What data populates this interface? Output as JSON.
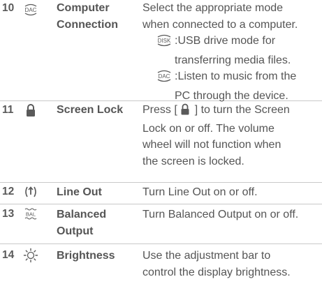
{
  "rows": [
    {
      "num": "10",
      "icon": "dac-icon",
      "name_lines": [
        "Computer",
        "Connection"
      ],
      "desc_lines": [
        "Select the appropriate mode",
        "when connected to a computer."
      ],
      "options": [
        {
          "icon": "disk-icon",
          "icon_text": "DISK",
          "lines": [
            ":USB drive mode for",
            "transferring media files."
          ]
        },
        {
          "icon": "dac-icon",
          "icon_text": "DAC",
          "lines": [
            ":Listen to music from the",
            "PC through the device."
          ]
        }
      ]
    },
    {
      "num": "11",
      "icon": "lock-icon",
      "name_lines": [
        "Screen Lock"
      ],
      "desc_parts": {
        "before": "Press [",
        "after": "] to turn the Screen"
      },
      "desc_lines": [
        "Lock on or off. The volume",
        "wheel will not function when",
        "the screen is locked."
      ]
    },
    {
      "num": "12",
      "icon": "line-out-icon",
      "name_lines": [
        "Line Out"
      ],
      "desc_lines": [
        "Turn Line Out on or off."
      ]
    },
    {
      "num": "13",
      "icon": "balanced-icon",
      "icon_text": "BAL",
      "name_lines": [
        "Balanced",
        "Output"
      ],
      "desc_lines": [
        "Turn Balanced Output on or off."
      ]
    },
    {
      "num": "14",
      "icon": "brightness-icon",
      "name_lines": [
        "Brightness"
      ],
      "desc_lines": [
        "Use the adjustment bar to",
        "control the display brightness."
      ]
    }
  ]
}
